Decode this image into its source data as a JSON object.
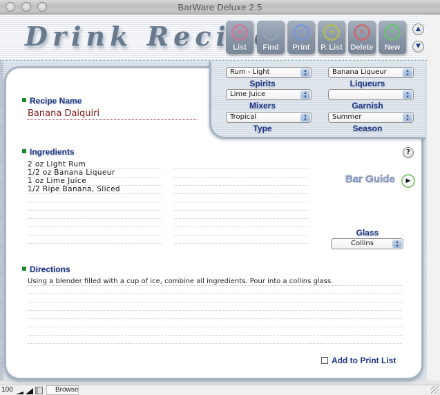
{
  "window": {
    "title": "BarWare Deluxe 2.5"
  },
  "header": {
    "app_title": "Drink Recipe",
    "toolbar": [
      {
        "label": "List",
        "icon": "list-icon",
        "color": "#d9708f",
        "glyph": "≡"
      },
      {
        "label": "Find",
        "icon": "find-icon",
        "color": "#9aa4bf",
        "glyph": "○"
      },
      {
        "label": "Print",
        "icon": "print-icon",
        "color": "#6f95e0",
        "glyph": "✓"
      },
      {
        "label": "P. List",
        "icon": "print-list-icon",
        "color": "#b7c24a",
        "glyph": "➜"
      },
      {
        "label": "Delete",
        "icon": "delete-icon",
        "color": "#d66060",
        "glyph": "✕"
      },
      {
        "label": "New",
        "icon": "new-icon",
        "color": "#62c76a",
        "glyph": "+"
      }
    ],
    "nav": {
      "up": "▲",
      "down": "▼"
    }
  },
  "selectors": {
    "spirits": {
      "label": "Spirits",
      "value": "Rum - Light"
    },
    "liqueurs": {
      "label": "Liqueurs",
      "value": "Banana Liqueur"
    },
    "mixers": {
      "label": "Mixers",
      "value": "Lime Juice"
    },
    "garnish": {
      "label": "Garnish",
      "value": ""
    },
    "type": {
      "label": "Type",
      "value": "Tropical"
    },
    "season": {
      "label": "Season",
      "value": "Summer"
    },
    "glass": {
      "label": "Glass",
      "value": "Collins"
    },
    "stepper_glyph": "▲▼"
  },
  "recipe": {
    "name_label": "Recipe Name",
    "name": "Banana Daiquiri",
    "ingredients_label": "Ingredients",
    "ingredients_left": [
      "2 oz Light Rum",
      "1/2 oz Banana Liqueur",
      "1 oz Lime Juice",
      "1/2 Ripe Banana, Sliced",
      "",
      "",
      "",
      "",
      "",
      ""
    ],
    "ingredients_right": [
      "",
      "",
      "",
      "",
      "",
      "",
      "",
      "",
      "",
      ""
    ],
    "directions_label": "Directions",
    "directions": [
      "Using a blender filled with a cup of ice, combine all ingredients. Pour into a collins glass.",
      "",
      "",
      "",
      "",
      "",
      "",
      ""
    ]
  },
  "help": {
    "glyph": "?"
  },
  "bar_guide": {
    "label": "Bar Guide",
    "glyph": "▶"
  },
  "print_list": {
    "label": "Add to Print List",
    "checked": false
  },
  "statusbar": {
    "zoom": "100",
    "mode": "Browse"
  }
}
